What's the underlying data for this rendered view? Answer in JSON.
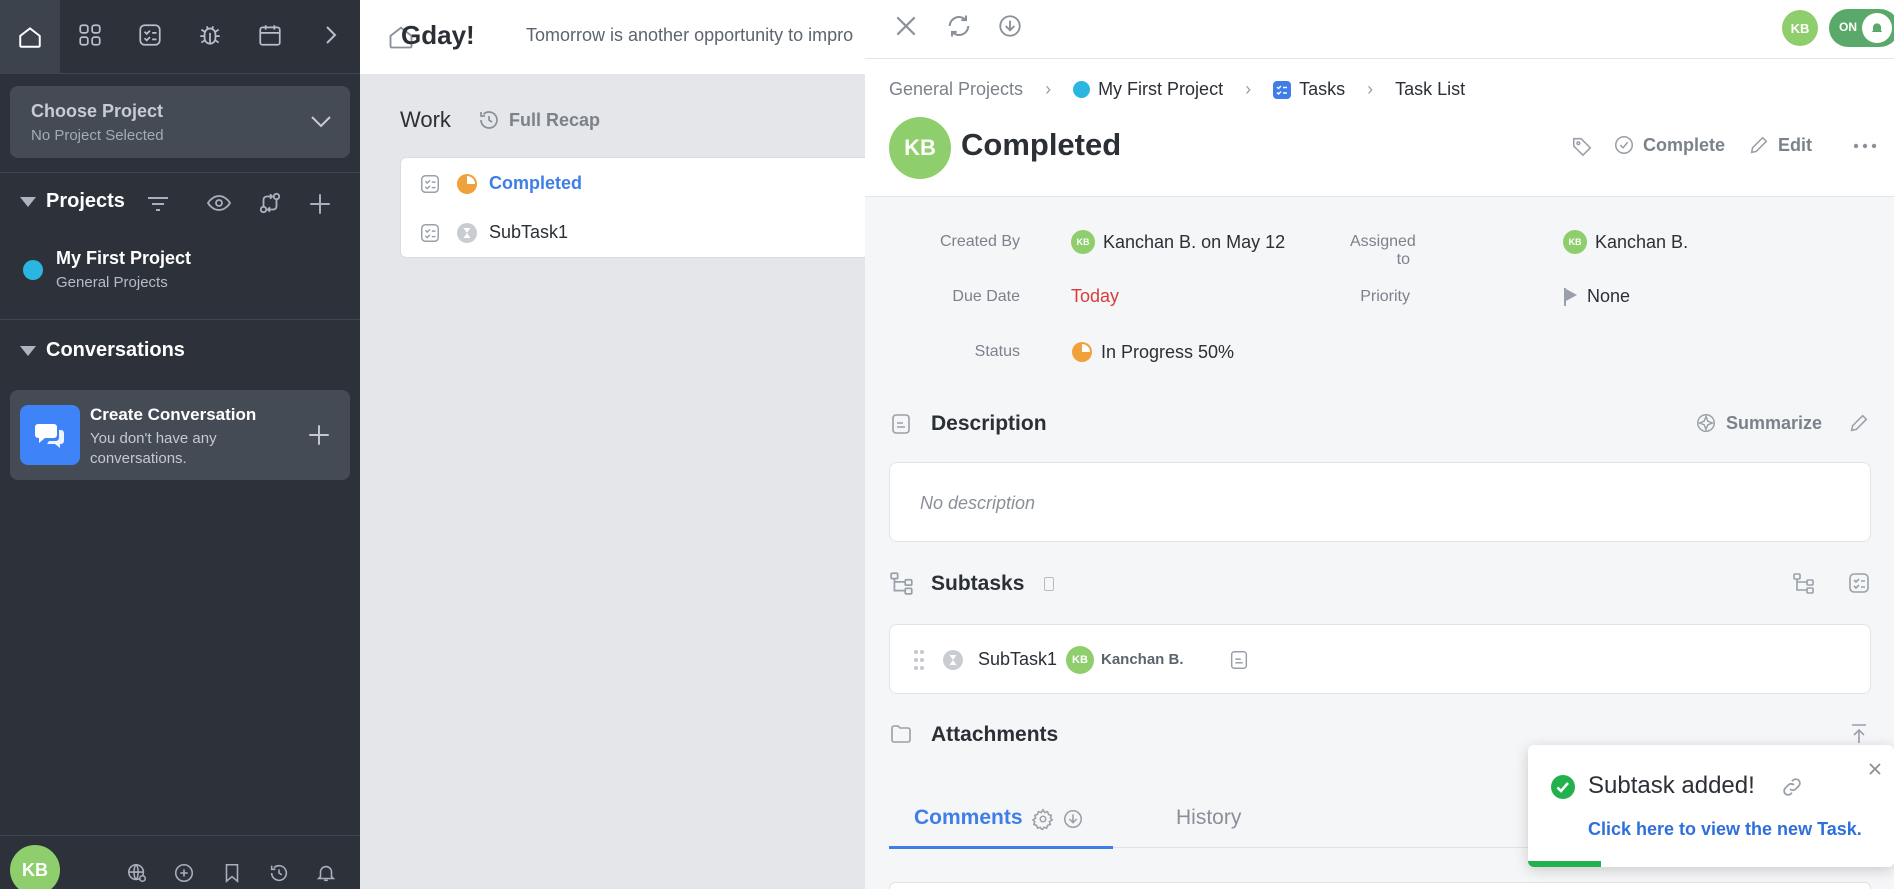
{
  "sidebar": {
    "project_chooser": {
      "title": "Choose Project",
      "subtitle": "No Project Selected"
    },
    "projects_heading": "Projects",
    "project": {
      "name": "My First Project",
      "group": "General Projects",
      "color": "#2bb6e2"
    },
    "conversations_heading": "Conversations",
    "conversation": {
      "title": "Create Conversation",
      "subtitle_1": "You don't have any",
      "subtitle_2": "conversations."
    },
    "user_initials": "KB"
  },
  "main": {
    "greeting": "Gday!",
    "greeting_sub": "Tomorrow is another opportunity to impro",
    "work_label": "Work",
    "recap_label": "Full Recap",
    "items": [
      {
        "label": "Completed",
        "status": "in-progress"
      },
      {
        "label": "SubTask1",
        "status": "pending"
      }
    ]
  },
  "panel": {
    "toggle_label": "ON",
    "user_initials": "KB",
    "breadcrumb": [
      "General Projects",
      "My First Project",
      "Tasks",
      "Task List"
    ],
    "task": {
      "initials": "KB",
      "title": "Completed"
    },
    "actions": {
      "complete": "Complete",
      "edit": "Edit"
    },
    "fields": {
      "created_by_label": "Created By",
      "created_by_value": "Kanchan B. on May 12",
      "assigned_label": "Assigned to",
      "assigned_value": "Kanchan B.",
      "due_label": "Due Date",
      "due_value": "Today",
      "priority_label": "Priority",
      "priority_value": "None",
      "status_label": "Status",
      "status_value": "In Progress 50%",
      "avatar_initials": "KB"
    },
    "description": {
      "heading": "Description",
      "summarize": "Summarize",
      "empty_text": "No description"
    },
    "subtasks": {
      "heading": "Subtasks",
      "item_name": "SubTask1",
      "item_assignee": "Kanchan B.",
      "item_initials": "KB"
    },
    "attachments_heading": "Attachments",
    "tabs": {
      "comments": "Comments",
      "history": "History"
    }
  },
  "toast": {
    "title": "Subtask added!",
    "link": "Click here to view the new Task.",
    "progress": 0.2
  },
  "colors": {
    "accent": "#3f7ee8",
    "sidebar_bg": "#2d323a",
    "avatar": "#8fce6c",
    "danger": "#d93b3b",
    "progress_orange": "#f0a13b",
    "success": "#22b14c"
  }
}
